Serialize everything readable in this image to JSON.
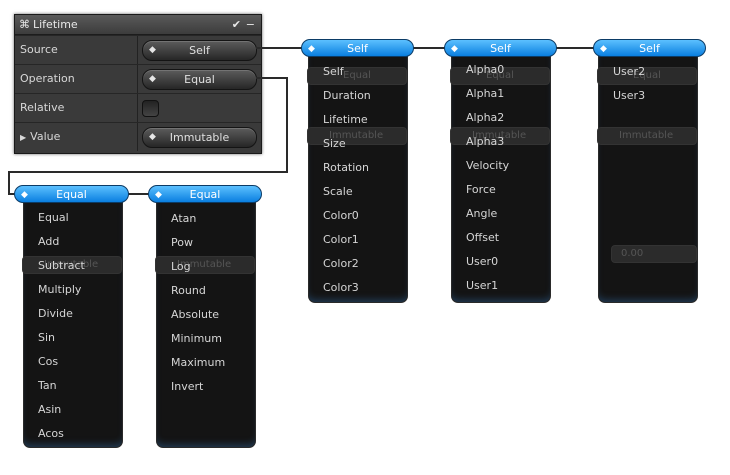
{
  "panel": {
    "title": "Lifetime",
    "title_icon": "⌘",
    "check_icon": "✔",
    "minimize_icon": "−",
    "rows": [
      {
        "label": "Source",
        "value": "Self"
      },
      {
        "label": "Operation",
        "value": "Equal"
      },
      {
        "label": "Relative",
        "value": ""
      },
      {
        "label": "Value",
        "value": "Immutable"
      }
    ]
  },
  "dropdown_self_1": {
    "header": "Self",
    "items": [
      "Self",
      "Duration",
      "Lifetime",
      "Size",
      "Rotation",
      "Scale",
      "Color0",
      "Color1",
      "Color2",
      "Color3"
    ],
    "ghosts": [
      "Equal",
      "Immutable"
    ]
  },
  "dropdown_self_2": {
    "header": "Self",
    "items": [
      "Alpha0",
      "Alpha1",
      "Alpha2",
      "Alpha3",
      "Velocity",
      "Force",
      "Angle",
      "Offset",
      "User0",
      "User1"
    ],
    "ghosts": [
      "Equal",
      "Immutable"
    ]
  },
  "dropdown_self_3": {
    "header": "Self",
    "items": [
      "User2",
      "User3"
    ],
    "ghosts": [
      "Equal",
      "Immutable",
      "0.00"
    ]
  },
  "dropdown_equal_1": {
    "header": "Equal",
    "items": [
      "Equal",
      "Add",
      "Subtract",
      "Multiply",
      "Divide",
      "Sin",
      "Cos",
      "Tan",
      "Asin",
      "Acos"
    ],
    "ghosts": [
      "Immutable"
    ]
  },
  "dropdown_equal_2": {
    "header": "Equal",
    "items": [
      "Atan",
      "Pow",
      "Log",
      "Round",
      "Absolute",
      "Minimum",
      "Maximum",
      "Invert"
    ],
    "ghosts": [
      "Immutable"
    ]
  },
  "colors": {
    "accent": "#1a8ff0",
    "panel_bg": "#3a3a3a",
    "menu_bg": "#141414"
  }
}
